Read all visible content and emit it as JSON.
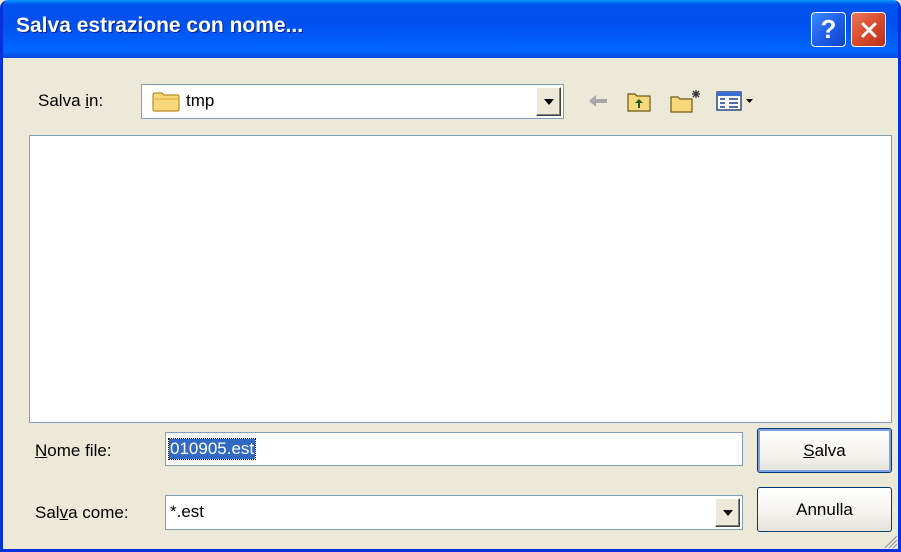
{
  "window": {
    "title": "Salva estrazione con nome..."
  },
  "titlebar": {
    "help_label": "?"
  },
  "save_in": {
    "label_prefix": "Salva ",
    "label_key": "i",
    "label_suffix": "n:",
    "value": "tmp",
    "icon": "folder-icon"
  },
  "toolbar": {
    "icons": [
      "back-arrow-icon",
      "up-folder-icon",
      "new-folder-icon",
      "view-menu-icon"
    ]
  },
  "file_name": {
    "label_key": "N",
    "label_suffix": "ome file:",
    "value": "010905.est"
  },
  "save_as_type": {
    "label_prefix": "Sal",
    "label_key": "v",
    "label_suffix": "a come:",
    "value": "*.est"
  },
  "buttons": {
    "save_key": "S",
    "save_suffix": "alva",
    "cancel": "Annulla"
  },
  "colors": {
    "titlebar": "#0054e3",
    "dialog_bg": "#ece9d8",
    "selection": "#316ac5",
    "close_button": "#d94b2e"
  }
}
